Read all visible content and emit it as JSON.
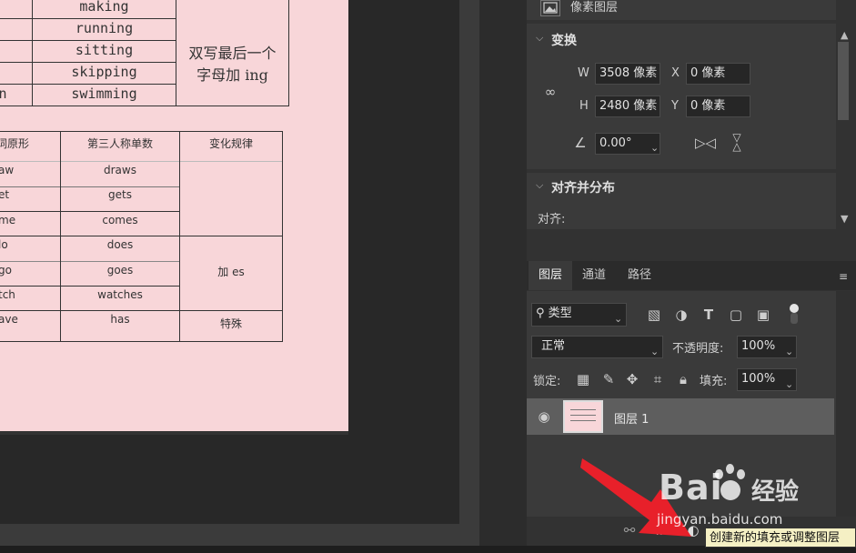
{
  "doc": {
    "table1": {
      "rows": [
        "making",
        "running",
        "sitting",
        "skipping",
        "swimming"
      ],
      "row4_left": "n",
      "rule_line1": "双写最后一个",
      "rule_line2": "字母加 ing"
    },
    "table2": {
      "headers": [
        "词原形",
        "第三人称单数",
        "变化规律"
      ],
      "rows": [
        {
          "base": "aw",
          "third": "draws"
        },
        {
          "base": "et",
          "third": "gets"
        },
        {
          "base": "me",
          "third": "comes"
        },
        {
          "base": "lo",
          "third": "does"
        },
        {
          "base": "go",
          "third": "goes"
        },
        {
          "base": "tch",
          "third": "watches"
        },
        {
          "base": "ave",
          "third": "has"
        }
      ],
      "rule_es": "加 es",
      "rule_special": "特殊"
    }
  },
  "panel": {
    "layer_type_label": "像素图层",
    "transform": {
      "title": "变换",
      "w_label": "W",
      "w_value": "3508 像素",
      "h_label": "H",
      "h_value": "2480 像素",
      "x_label": "X",
      "x_value": "0 像素",
      "y_label": "Y",
      "y_value": "0 像素",
      "angle_value": "0.00°"
    },
    "align": {
      "title": "对齐并分布",
      "align_label": "对齐:"
    }
  },
  "layers": {
    "tabs": [
      "图层",
      "通道",
      "路径"
    ],
    "active_tab": "图层",
    "filter_type": "类型",
    "blend_mode": "正常",
    "opacity_label": "不透明度:",
    "opacity_value": "100%",
    "lock_label": "锁定:",
    "fill_label": "填充:",
    "fill_value": "100%",
    "items": [
      {
        "name": "图层 1",
        "visible": true
      }
    ]
  },
  "tooltip": {
    "text": "创建新的填充或调整图层"
  },
  "watermark": {
    "brand": "Bai",
    "brand2": "经验",
    "url": "jingyan.baidu.com"
  },
  "colors": {
    "doc_bg": "#f8d6d9",
    "arrow": "#e8202a",
    "panel_bg": "#323232"
  }
}
